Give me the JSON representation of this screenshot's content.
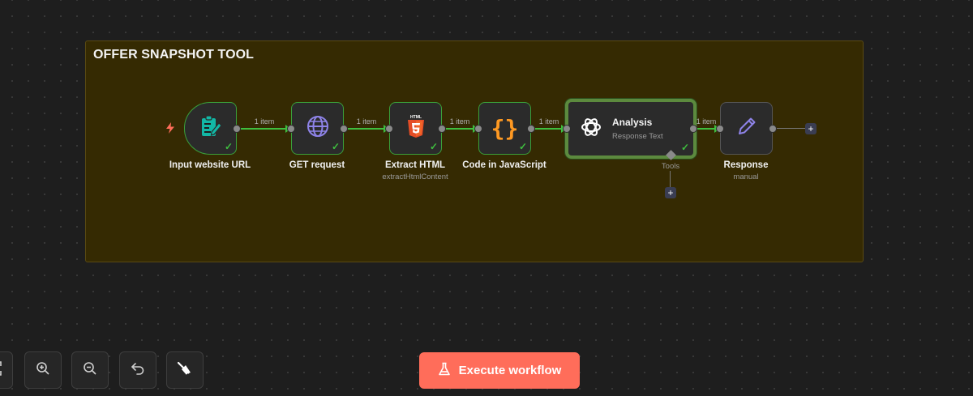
{
  "sticky_note": {
    "title": "OFFER SNAPSHOT TOOL"
  },
  "nodes": [
    {
      "name": "Input website URL",
      "subtitle": "",
      "icon": "form-trigger-icon",
      "status": "success"
    },
    {
      "name": "GET request",
      "subtitle": "",
      "icon": "globe-icon",
      "status": "success"
    },
    {
      "name": "Extract HTML",
      "subtitle": "extractHtmlContent",
      "icon": "html5-icon",
      "status": "success"
    },
    {
      "name": "Code in JavaScript",
      "subtitle": "",
      "icon": "braces-icon",
      "status": "success"
    },
    {
      "name": "Analysis",
      "subtitle": "Response Text",
      "icon": "openai-icon",
      "status": "success",
      "tools_label": "Tools"
    },
    {
      "name": "Response",
      "subtitle": "manual",
      "icon": "pencil-icon",
      "status": ""
    }
  ],
  "connections": [
    {
      "label": "1 item"
    },
    {
      "label": "1 item"
    },
    {
      "label": "1 item"
    },
    {
      "label": "1 item"
    },
    {
      "label": "1 item"
    }
  ],
  "toolbar": {
    "execute_label": "Execute workflow",
    "buttons": [
      "fit-view-icon",
      "zoom-in-icon",
      "zoom-out-icon",
      "undo-icon",
      "clear-icon"
    ]
  },
  "colors": {
    "accent": "#ff6d5a",
    "success": "#3fbf3f",
    "sticky": "#352a02",
    "node_bg": "#2b2b2b"
  }
}
